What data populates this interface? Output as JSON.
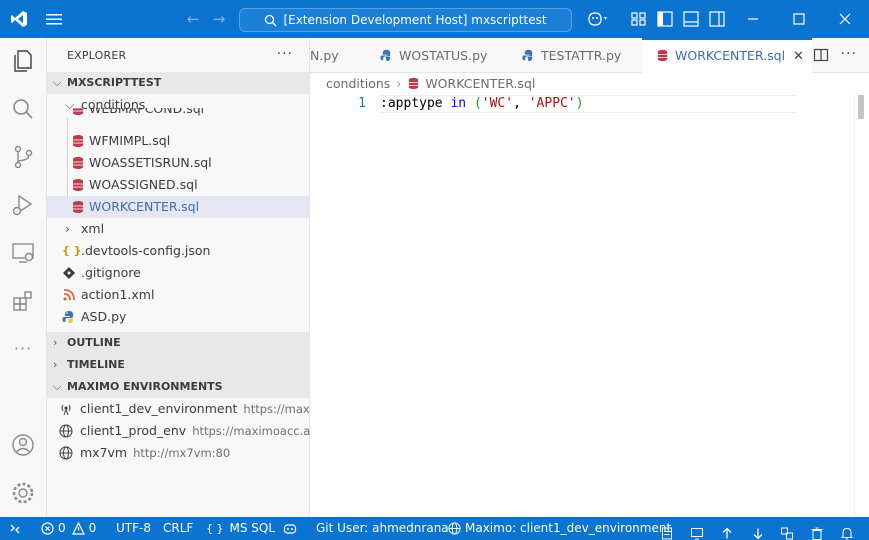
{
  "titlebar": {
    "search_text": "[Extension Development Host] mxscripttest"
  },
  "activitybar": {
    "icons": [
      "explorer-icon",
      "search-icon",
      "source-control-icon",
      "run-debug-icon",
      "remote-explorer-icon",
      "extensions-icon",
      "more-icon",
      "accounts-icon",
      "manage-icon"
    ]
  },
  "sidebar": {
    "title": "EXPLORER",
    "more": "···",
    "workspace_header": "MXSCRIPTTEST",
    "folder": "conditions",
    "files": [
      "WEBMAPCOND.sql",
      "WFMIMPL.sql",
      "WOASSETISRUN.sql",
      "WOASSIGNED.sql",
      "WORKCENTER.sql"
    ],
    "xml_folder": "xml",
    "root_files": [
      ".devtools-config.json",
      ".gitignore",
      "action1.xml",
      "ASD.py"
    ],
    "outline": "OUTLINE",
    "timeline": "TIMELINE",
    "maximo_header": "MAXIMO ENVIRONMENTS",
    "environments": [
      {
        "name": "client1_dev_environment",
        "url": "https://max..."
      },
      {
        "name": "client1_prod_env",
        "url": "https://maximoacc.a..."
      },
      {
        "name": "mx7vm",
        "url": "http://mx7vm:80"
      }
    ]
  },
  "tabs": [
    {
      "label": "N.py"
    },
    {
      "label": "WOSTATUS.py"
    },
    {
      "label": "TESTATTR.py"
    },
    {
      "label": "WORKCENTER.sql",
      "close": "✕"
    }
  ],
  "breadcrumb": {
    "folder": "conditions",
    "file": "WORKCENTER.sql"
  },
  "editor": {
    "line_number": "1",
    "tokens": {
      "t1": ":apptype ",
      "t2": "in",
      "t3": " ",
      "t4": "(",
      "t5": "'WC'",
      "t6": ", ",
      "t7": "'APPC'",
      "t8": ")"
    }
  },
  "statusbar": {
    "errors": "0",
    "warnings": "0",
    "encoding": "UTF-8",
    "eol": "CRLF",
    "language": "MS SQL",
    "git_user": "Git User: ahmednrana",
    "maximo": "Maximo: client1_dev_environment"
  },
  "colors": {
    "accent": "#0a74d0",
    "selection": "#e4e6f1",
    "sql_icon": "#c0394b",
    "python_icon": "#3a75b0"
  }
}
